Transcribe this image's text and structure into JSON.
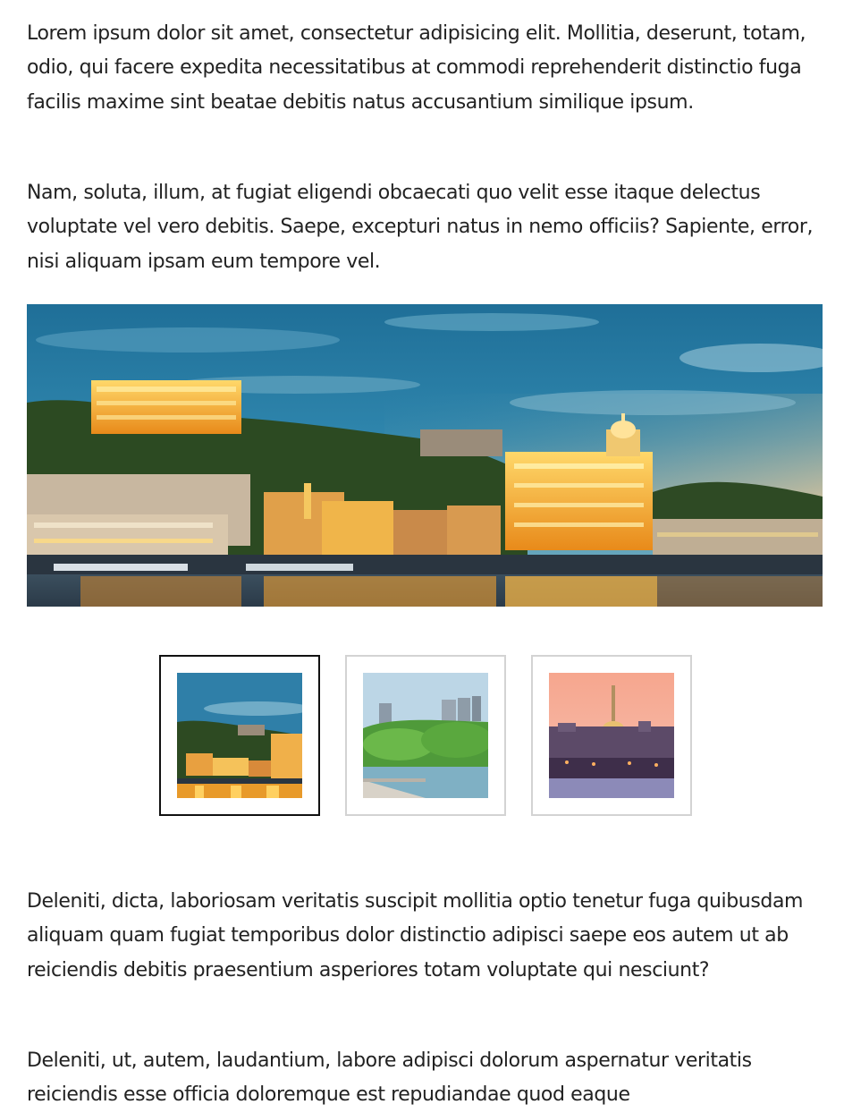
{
  "article": {
    "paragraphs": [
      "Lorem ipsum dolor sit amet, consectetur adipisicing elit. Mollitia, deserunt, totam, odio, qui facere expedita necessitatibus at commodi reprehenderit distinctio fuga facilis maxime sint beatae debitis natus accusantium similique ipsum.",
      "Nam, soluta, illum, at fugiat eligendi obcaecati quo velit esse itaque delectus voluptate vel vero debitis. Saepe, excepturi natus in nemo officiis? Sapiente, error, nisi aliquam ipsam eum tempore vel.",
      "Deleniti, dicta, laboriosam veritatis suscipit mollitia optio tenetur fuga quibusdam aliquam quam fugiat temporibus dolor distinctio adipisci saepe eos autem ut ab reiciendis debitis praesentium asperiores totam voluptate qui nesciunt?",
      "Deleniti, ut, autem, laudantium, labore adipisci dolorum aspernatur veritatis reiciendis esse officia doloremque est repudiandae quod eaque"
    ]
  },
  "gallery": {
    "selected_index": 0,
    "count": 3,
    "colors": {
      "active_border": "#111111",
      "inactive_border": "#d3d3d3",
      "sky": "#2f7fa8",
      "lights": "#ffb732",
      "sunset": "#f3a48c"
    }
  }
}
